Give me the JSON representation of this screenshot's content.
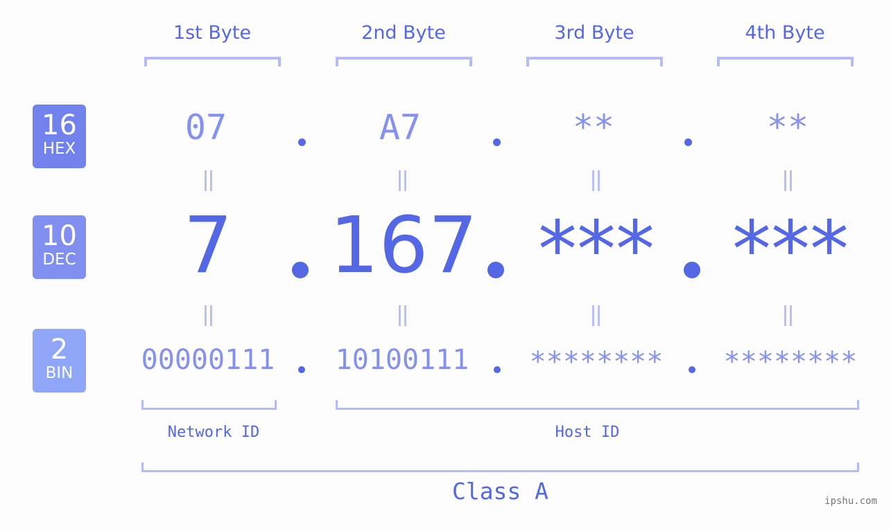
{
  "bytes": {
    "headers": [
      "1st Byte",
      "2nd Byte",
      "3rd Byte",
      "4th Byte"
    ]
  },
  "bases": [
    {
      "number": "16",
      "label": "HEX",
      "color": "#7282ec"
    },
    {
      "number": "10",
      "label": "DEC",
      "color": "#8190f0"
    },
    {
      "number": "2",
      "label": "BIN",
      "color": "#90a6f8"
    }
  ],
  "hex": [
    "07",
    "A7",
    "**",
    "**"
  ],
  "dec": [
    "7",
    "167",
    "***",
    "***"
  ],
  "bin": [
    "00000111",
    "10100111",
    "********",
    "********"
  ],
  "separator": ".",
  "ids": {
    "network": "Network ID",
    "host": "Host ID"
  },
  "ip_class": "Class A",
  "watermark": "ipshu.com",
  "colors": {
    "accent": "#5468e6",
    "light_text": "#8591ee",
    "bracket": "#b3bcf6"
  }
}
